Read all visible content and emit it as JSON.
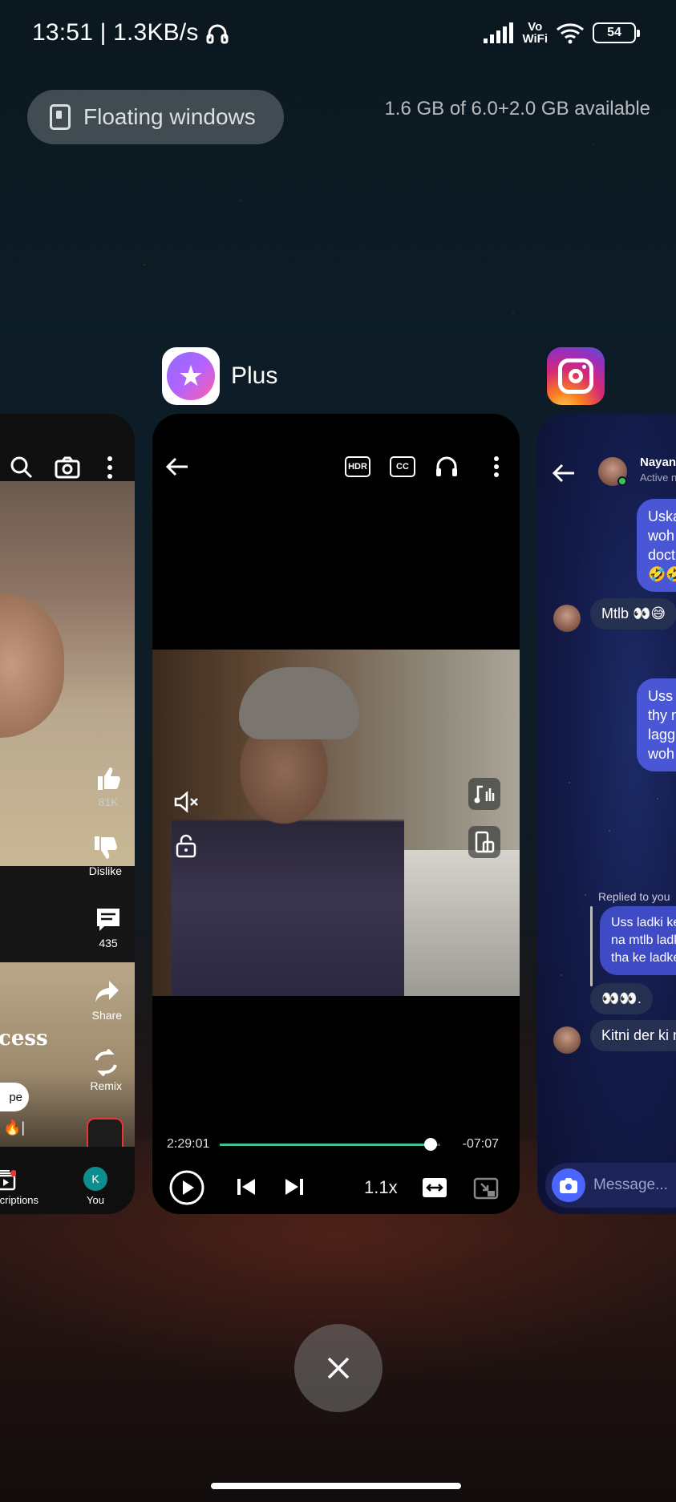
{
  "status_bar": {
    "time_speed": "13:51 | 1.3KB/s",
    "volte_top": "Vo",
    "volte_bottom": "WiFi",
    "battery": "54"
  },
  "recents": {
    "floating_windows_label": "Floating windows",
    "memory_info": "1.6 GB of 6.0+2.0 GB available"
  },
  "apps": {
    "center_app_name": "Plus"
  },
  "youtube_card": {
    "like_count": "81K",
    "dislike_label": "Dislike",
    "comment_count": "435",
    "share_label": "Share",
    "remix_label": "Remix",
    "caption_fragment": "cess",
    "pill_fragment": "pe",
    "nav_subscriptions": "Subscriptions",
    "nav_you": "You",
    "avatar_letter": "K"
  },
  "player_card": {
    "elapsed": "2:29:01",
    "remaining": "-07:07",
    "progress_fraction": 0.955,
    "speed": "1.1x",
    "hdr_label": "HDR",
    "cc_label": "CC"
  },
  "instagram_card": {
    "contact_name": "Nayan",
    "active_status": "Active n",
    "messages": [
      {
        "from": "me",
        "lines": [
          "Uska",
          "woh",
          "doct",
          "🤣🤣"
        ]
      },
      {
        "from": "them",
        "text": "Mtlb 👀😅"
      },
      {
        "from": "me",
        "lines": [
          "Uss",
          "thy n",
          "lagg",
          "woh"
        ]
      },
      {
        "from": "them",
        "text": "👀👀."
      },
      {
        "from": "them",
        "text": "Kitni der ki n"
      }
    ],
    "replied_label": "Replied to you",
    "quote_lines": [
      "Uss ladki ke",
      "na mtlb ladk",
      "tha ke ladke"
    ],
    "message_placeholder": "Message..."
  },
  "colors": {
    "progress_accent": "#3fbf9a",
    "instagram_bubble": "#4956d6"
  }
}
